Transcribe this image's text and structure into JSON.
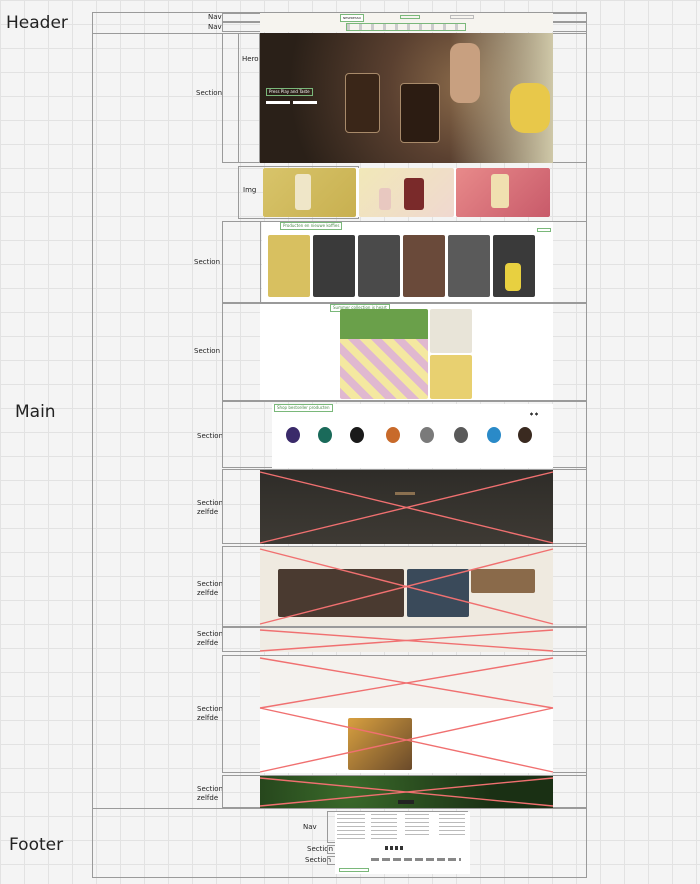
{
  "zones": {
    "header": "Header",
    "main": "Main",
    "footer": "Footer"
  },
  "nav_labels": [
    "Nav",
    "Nav"
  ],
  "section_labels": {
    "hero_section": "Section",
    "hero": "Hero",
    "img": "Img",
    "section_products": "Section",
    "section_summer": "Section",
    "section_bestsellers": "Section",
    "section_z1": "Section\nzelfde",
    "section_z2": "Section\nzelfde",
    "section_z3": "Section\nzelfde",
    "section_z4": "Section\nzelfde",
    "section_z5": "Section\nzelfde",
    "footer_nav": "Nav",
    "footer_section1": "Section",
    "footer_section2": "Section"
  },
  "tags": {
    "products_h2": "Producten en nieuwe koffies",
    "summer_h3": "Summer collection is heart",
    "bestseller_h2": "Shop bestseller producten",
    "hero_text": "Press Play and Taste",
    "logo": "NESPRESSO"
  },
  "colors": {
    "red_x": "#f07070",
    "green_tag": "#7ab87a",
    "hero_dark": "#3a2a1c",
    "product_band": "#2a2a2a",
    "leaf_green": "#1f3a1a"
  }
}
